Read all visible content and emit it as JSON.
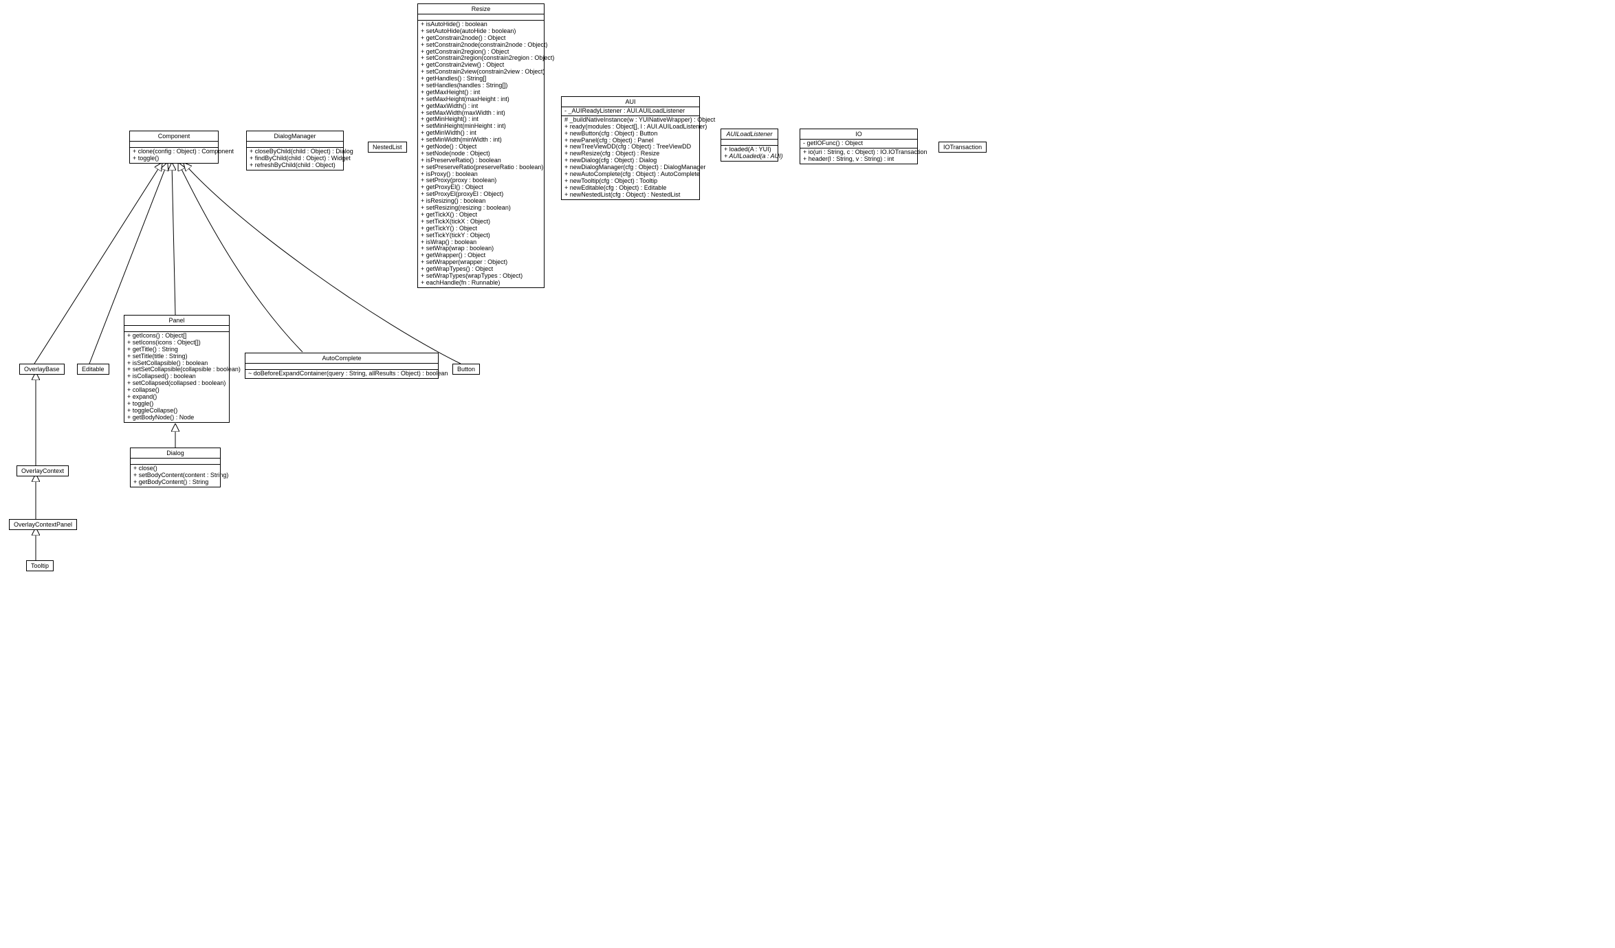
{
  "classes": {
    "Component": {
      "name": "Component",
      "attrs": [],
      "ops": [
        "+ clone(config : Object) : Component",
        "+ toggle()"
      ]
    },
    "DialogManager": {
      "name": "DialogManager",
      "attrs": [],
      "ops": [
        "+ closeByChild(child : Object) : Dialog",
        "+ findByChild(child : Object) : Widget",
        "+ refreshByChild(child : Object)"
      ]
    },
    "NestedList": {
      "name": "NestedList",
      "attrs": [],
      "ops": []
    },
    "Resize": {
      "name": "Resize",
      "attrs": [],
      "ops": [
        "+ isAutoHide() : boolean",
        "+ setAutoHide(autoHide : boolean)",
        "+ getConstrain2node() : Object",
        "+ setConstrain2node(constrain2node : Object)",
        "+ getConstrain2region() : Object",
        "+ setConstrain2region(constrain2region : Object)",
        "+ getConstrain2view() : Object",
        "+ setConstrain2view(constrain2view : Object)",
        "+ getHandles() : String[]",
        "+ setHandles(handles : String[])",
        "+ getMaxHeight() : int",
        "+ setMaxHeight(maxHeight : int)",
        "+ getMaxWidth() : int",
        "+ setMaxWidth(maxWidth : int)",
        "+ getMinHeight() : int",
        "+ setMinHeight(minHeight : int)",
        "+ getMinWidth() : int",
        "+ setMinWidth(minWidth : int)",
        "+ getNode() : Object",
        "+ setNode(node : Object)",
        "+ isPreserveRatio() : boolean",
        "+ setPreserveRatio(preserveRatio : boolean)",
        "+ isProxy() : boolean",
        "+ setProxy(proxy : boolean)",
        "+ getProxyEl() : Object",
        "+ setProxyEl(proxyEl : Object)",
        "+ isResizing() : boolean",
        "+ setResizing(resizing : boolean)",
        "+ getTickX() : Object",
        "+ setTickX(tickX : Object)",
        "+ getTickY() : Object",
        "+ setTickY(tickY : Object)",
        "+ isWrap() : boolean",
        "+ setWrap(wrap : boolean)",
        "+ getWrapper() : Object",
        "+ setWrapper(wrapper : Object)",
        "+ getWrapTypes() : Object",
        "+ setWrapTypes(wrapTypes : Object)",
        "+ eachHandle(fn : Runnable)"
      ]
    },
    "AUI": {
      "name": "AUI",
      "attrs": [
        "- _AUIReadyListener : AUI.AUILoadListener"
      ],
      "ops": [
        "# _buildNativeInstance(w : YUINativeWrapper) : Object",
        "+ ready(modules : Object[], l : AUI.AUILoadListener)",
        "+ newButton(cfg : Object) : Button",
        "+ newPanel(cfg : Object) : Panel",
        "+ newTreeViewDD(cfg : Object) : TreeViewDD",
        "+ newResize(cfg : Object) : Resize",
        "+ newDialog(cfg : Object) : Dialog",
        "+ newDialogManager(cfg : Object) : DialogManager",
        "+ newAutoComplete(cfg : Object) : AutoComplete",
        "+ newTooltip(cfg : Object) : Tooltip",
        "+ newEditable(cfg : Object) : Editable",
        "+ newNestedList(cfg : Object) : NestedList"
      ]
    },
    "AUILoadListener": {
      "name": "AUILoadListener",
      "attrs": [],
      "ops": [
        "+ loaded(A : YUI)",
        "+ AUILoaded(a : AUI)"
      ],
      "italicOps": [
        1
      ]
    },
    "IO": {
      "name": "IO",
      "attrs": [
        "- getIOFunc() : Object"
      ],
      "ops": [
        "+ io(uri : String, c : Object) : IO.IOTransaction",
        "+ header(l : String, v : String) : int"
      ]
    },
    "IOTransaction": {
      "name": "IOTransaction",
      "attrs": [],
      "ops": []
    },
    "OverlayBase": {
      "name": "OverlayBase",
      "attrs": [],
      "ops": []
    },
    "Editable": {
      "name": "Editable",
      "attrs": [],
      "ops": []
    },
    "Panel": {
      "name": "Panel",
      "attrs": [],
      "ops": [
        "+ getIcons() : Object[]",
        "+ setIcons(icons : Object[])",
        "+ getTitle() : String",
        "+ setTitle(title : String)",
        "+ isSetCollapsible() : boolean",
        "+ setSetCollapsible(collapsible : boolean)",
        "+ isCollapsed() : boolean",
        "+ setCollapsed(collapsed : boolean)",
        "+ collapse()",
        "+ expand()",
        "+ toggle()",
        "+ toggleCollapse()",
        "+ getBodyNode() : Node"
      ]
    },
    "AutoComplete": {
      "name": "AutoComplete",
      "attrs": [],
      "ops": [
        "~ doBeforeExpandContainer(query : String, allResults : Object) : boolean"
      ]
    },
    "Button": {
      "name": "Button",
      "attrs": [],
      "ops": []
    },
    "OverlayContext": {
      "name": "OverlayContext",
      "attrs": [],
      "ops": []
    },
    "Dialog": {
      "name": "Dialog",
      "attrs": [],
      "ops": [
        "+ close()",
        "+ setBodyContent(content : String)",
        "+ getBodyContent() : String"
      ]
    },
    "OverlayContextPanel": {
      "name": "OverlayContextPanel",
      "attrs": [],
      "ops": []
    },
    "Tooltip": {
      "name": "Tooltip",
      "attrs": [],
      "ops": []
    }
  }
}
